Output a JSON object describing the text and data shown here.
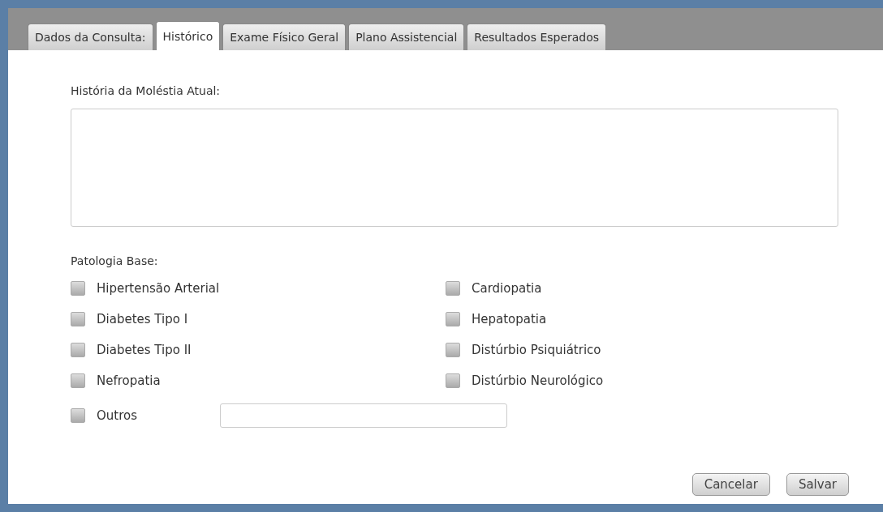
{
  "tabs": [
    {
      "label": "Dados da Consulta:",
      "selected": false
    },
    {
      "label": "Histórico",
      "selected": true
    },
    {
      "label": "Exame Físico Geral",
      "selected": false
    },
    {
      "label": "Plano Assistencial",
      "selected": false
    },
    {
      "label": "Resultados Esperados",
      "selected": false
    }
  ],
  "history": {
    "label": "História da Moléstia Atual:"
  },
  "pathology": {
    "label": "Patologia Base:",
    "left": [
      {
        "label": "Hipertensão Arterial",
        "checked": false
      },
      {
        "label": "Diabetes Tipo I",
        "checked": false
      },
      {
        "label": "Diabetes Tipo II",
        "checked": false
      },
      {
        "label": "Nefropatia",
        "checked": false
      }
    ],
    "right": [
      {
        "label": "Cardiopatia",
        "checked": false
      },
      {
        "label": "Hepatopatia",
        "checked": false
      },
      {
        "label": "Distúrbio Psiquiátrico",
        "checked": false
      },
      {
        "label": "Distúrbio Neurológico",
        "checked": false
      }
    ],
    "other": {
      "label": "Outros",
      "checked": false
    }
  },
  "buttons": [
    "Cancelar",
    "Salvar"
  ]
}
